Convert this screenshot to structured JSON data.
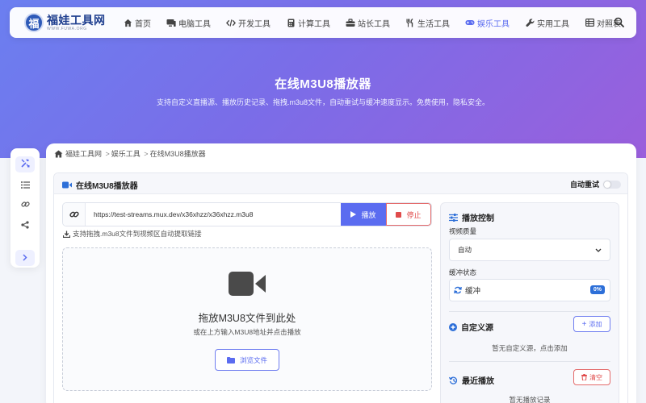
{
  "brand": {
    "logo_char": "福",
    "title": "福娃工具网",
    "subtitle": "WWW.FUWA.ORG"
  },
  "nav": {
    "items": [
      {
        "label": "首页",
        "icon": "home-icon"
      },
      {
        "label": "电脑工具",
        "icon": "desktop-icon"
      },
      {
        "label": "开发工具",
        "icon": "code-icon"
      },
      {
        "label": "计算工具",
        "icon": "calculator-icon"
      },
      {
        "label": "站长工具",
        "icon": "toolbox-icon"
      },
      {
        "label": "生活工具",
        "icon": "utensils-icon"
      },
      {
        "label": "娱乐工具",
        "icon": "gamepad-icon",
        "active": true
      },
      {
        "label": "实用工具",
        "icon": "wrench-icon"
      },
      {
        "label": "对照表",
        "icon": "table-icon"
      }
    ],
    "search_icon": "search-icon"
  },
  "hero": {
    "title": "在线M3U8播放器",
    "subtitle": "支持自定义直播源、播放历史记录、拖拽.m3u8文件，自动重试与缓冲速度显示。免费使用，隐私安全。"
  },
  "breadcrumb": {
    "home": "福娃工具网",
    "category": "娱乐工具",
    "current": "在线M3U8播放器"
  },
  "tool": {
    "title": "在线M3U8播放器",
    "auto_retry_label": "自动重试",
    "auto_retry_on": false,
    "url_value": "https://test-streams.mux.dev/x36xhzz/x36xhzz.m3u8",
    "play_label": "播放",
    "stop_label": "停止",
    "drag_hint": "支持拖拽.m3u8文件到视频区自动提取链接",
    "dropzone_title": "拖放M3U8文件到此处",
    "dropzone_sub": "或在上方输入M3U8地址并点击播放",
    "browse_label": "浏览文件"
  },
  "controls": {
    "heading": "播放控制",
    "quality_label": "视频质量",
    "quality_value": "自动",
    "buffer_label": "缓冲状态",
    "buffer_status": "缓冲",
    "buffer_percent": "0%",
    "custom_source_heading": "自定义源",
    "add_label": "添加",
    "custom_empty": "暂无自定义源，点击添加",
    "recent_heading": "最近播放",
    "clear_label": "清空",
    "recent_empty": "暂无播放记录"
  },
  "colors": {
    "accent": "#5b6cf0",
    "danger": "#e04b4b",
    "badge": "#2d6fd8",
    "hero_start": "#6b7ff0",
    "hero_end": "#9a5fdc"
  }
}
